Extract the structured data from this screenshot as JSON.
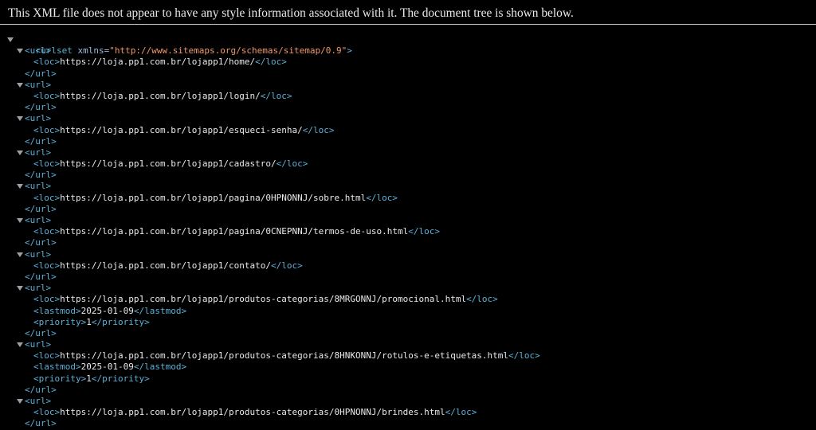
{
  "header": {
    "notice": "This XML file does not appear to have any style information associated with it. The document tree is shown below."
  },
  "root": {
    "open_tag": "<urlset",
    "attr_name": " xmlns=",
    "attr_value": "\"http://www.sitemaps.org/schemas/sitemap/0.9\"",
    "open_tag_end": ">"
  },
  "tags": {
    "url_open": "<url>",
    "url_close": "</url>",
    "loc_open": "<loc>",
    "loc_close": "</loc>",
    "lastmod_open": "<lastmod>",
    "lastmod_close": "</lastmod>",
    "priority_open": "<priority>",
    "priority_close": "</priority>"
  },
  "urls": [
    {
      "loc": "https://loja.pp1.com.br/lojapp1/home/"
    },
    {
      "loc": "https://loja.pp1.com.br/lojapp1/login/"
    },
    {
      "loc": "https://loja.pp1.com.br/lojapp1/esqueci-senha/"
    },
    {
      "loc": "https://loja.pp1.com.br/lojapp1/cadastro/"
    },
    {
      "loc": "https://loja.pp1.com.br/lojapp1/pagina/0HPNONNJ/sobre.html"
    },
    {
      "loc": "https://loja.pp1.com.br/lojapp1/pagina/0CNEPNNJ/termos-de-uso.html"
    },
    {
      "loc": "https://loja.pp1.com.br/lojapp1/contato/"
    },
    {
      "loc": "https://loja.pp1.com.br/lojapp1/produtos-categorias/8MRGONNJ/promocional.html",
      "lastmod": "2025-01-09",
      "priority": "1"
    },
    {
      "loc": "https://loja.pp1.com.br/lojapp1/produtos-categorias/8HNKONNJ/rotulos-e-etiquetas.html",
      "lastmod": "2025-01-09",
      "priority": "1"
    },
    {
      "loc": "https://loja.pp1.com.br/lojapp1/produtos-categorias/0HPNONNJ/brindes.html"
    }
  ],
  "colors": {
    "background": "#000000",
    "tag": "#5db0d7",
    "attribute_value": "#f29766",
    "text": "#e8eaed"
  }
}
